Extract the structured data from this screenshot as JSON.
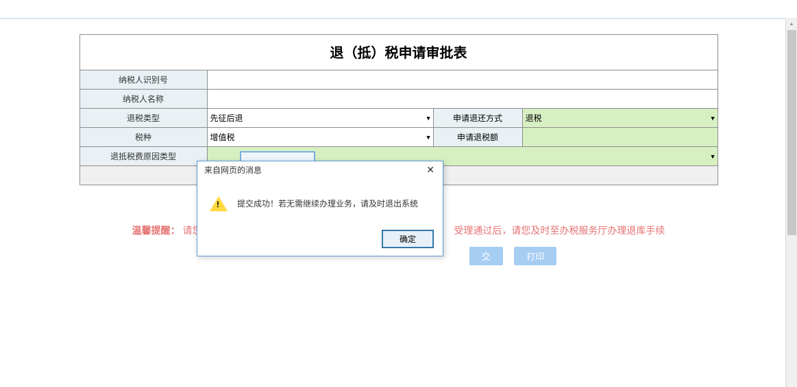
{
  "header": {
    "title": "退（抵）税申请审批表"
  },
  "form": {
    "taxpayer_id_label": "纳税人识别号",
    "taxpayer_id_value": "",
    "taxpayer_name_label": "纳税人名称",
    "taxpayer_name_value": "",
    "refund_type_label": "退税类型",
    "refund_type_value": "先征后退",
    "return_method_label": "申请退还方式",
    "return_method_value": "退税",
    "tax_kind_label": "税种",
    "tax_kind_value": "增值税",
    "refund_amount_label": "申请退税额",
    "refund_amount_value": "",
    "refund_reason_label": "退抵税费原因类型",
    "refund_reason_value": ""
  },
  "reminder": {
    "label": "温馨提醒：",
    "text_left": "请您",
    "text_right": "受理通过后，请您及时至办税服务厅办理退库手续"
  },
  "buttons": {
    "submit": "交",
    "print": "打印"
  },
  "dialog": {
    "title": "来自网页的消息",
    "message": "提交成功！若无需继续办理业务，请及时退出系统",
    "ok": "确定"
  }
}
